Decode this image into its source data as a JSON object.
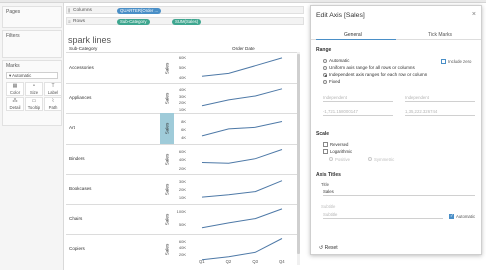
{
  "left_pane": {
    "pages_title": "Pages",
    "filters_title": "Filters",
    "marks_title": "Marks",
    "marks_type": "Automatic",
    "mark_buttons": [
      {
        "label": "Color",
        "icon": "palette-icon"
      },
      {
        "label": "Size",
        "icon": "size-icon"
      },
      {
        "label": "Label",
        "icon": "label-icon"
      },
      {
        "label": "Detail",
        "icon": "detail-icon"
      },
      {
        "label": "Tooltip",
        "icon": "tooltip-icon"
      },
      {
        "label": "Path",
        "icon": "path-icon"
      }
    ]
  },
  "shelves": {
    "columns_label": "Columns",
    "columns_pill": "QUARTER(Order ...",
    "rows_label": "Rows",
    "rows_pill_1": "Sub-Category",
    "rows_pill_2": "SUM(Sales)"
  },
  "sheet": {
    "title": "spark lines",
    "col_header_left": "Sub-Category",
    "col_header_right": "Order Date"
  },
  "chart_data": {
    "type": "line",
    "x_categories": [
      "Q1",
      "Q2",
      "Q3",
      "Q4"
    ],
    "y_axis_title": "Sales",
    "rows": [
      {
        "label": "Accessories",
        "ticks": [
          "60K",
          "50K",
          "40K"
        ],
        "values": [
          41,
          44,
          52,
          60
        ],
        "ylim": [
          37,
          62
        ],
        "highlight": false
      },
      {
        "label": "Appliances",
        "ticks": [
          "40K",
          "30K",
          "20K",
          "10K"
        ],
        "values": [
          15,
          24,
          30,
          41
        ],
        "ylim": [
          8,
          45
        ],
        "highlight": false
      },
      {
        "label": "Art",
        "ticks": [
          "8K",
          "6K",
          "4K"
        ],
        "values": [
          4.4,
          6.2,
          6.6,
          8.1
        ],
        "ylim": [
          3.2,
          9.4
        ],
        "highlight": true
      },
      {
        "label": "Binders",
        "ticks": [
          "60K",
          "40K",
          "20K"
        ],
        "values": [
          34,
          32,
          43,
          65
        ],
        "ylim": [
          14,
          72
        ],
        "highlight": false
      },
      {
        "label": "Bookcases",
        "ticks": [
          "30K",
          "20K",
          "10K"
        ],
        "values": [
          10,
          13,
          17,
          31
        ],
        "ylim": [
          5,
          36
        ],
        "highlight": false
      },
      {
        "label": "Chairs",
        "ticks": [
          "100K",
          "50K"
        ],
        "values": [
          38,
          56,
          72,
          108
        ],
        "ylim": [
          25,
          115
        ],
        "highlight": false
      },
      {
        "label": "Copiers",
        "ticks": [
          "60K",
          "40K",
          "20K"
        ],
        "values": [
          5,
          14,
          27,
          68
        ],
        "ylim": [
          0,
          72
        ],
        "highlight": false
      }
    ]
  },
  "dialog": {
    "title": "Edit Axis [Sales]",
    "close": "×",
    "tab_general": "General",
    "tab_tick_marks": "Tick Marks",
    "range": {
      "title": "Range",
      "options": [
        "Automatic",
        "Uniform axis range for all rows or columns",
        "Independent axis ranges for each row or column",
        "Fixed"
      ],
      "selected_index": 2,
      "include_zero": "Include zero",
      "start_dropdown": "Independent",
      "end_dropdown": "Independent",
      "start_value": "-1,721.158000147",
      "end_value": "1,35,222.326744"
    },
    "scale": {
      "title": "Scale",
      "reversed": "Reversed",
      "logarithmic": "Logarithmic",
      "positive": "Positive",
      "symmetric": "Symmetric"
    },
    "axis_titles": {
      "title": "Axis Titles",
      "title_label": "Title",
      "title_value": "Sales",
      "subtitle_label": "Subtitle",
      "subtitle_placeholder": "Subtitle",
      "automatic": "Automatic"
    },
    "reset": "Reset",
    "reset_icon": "reset-icon"
  }
}
